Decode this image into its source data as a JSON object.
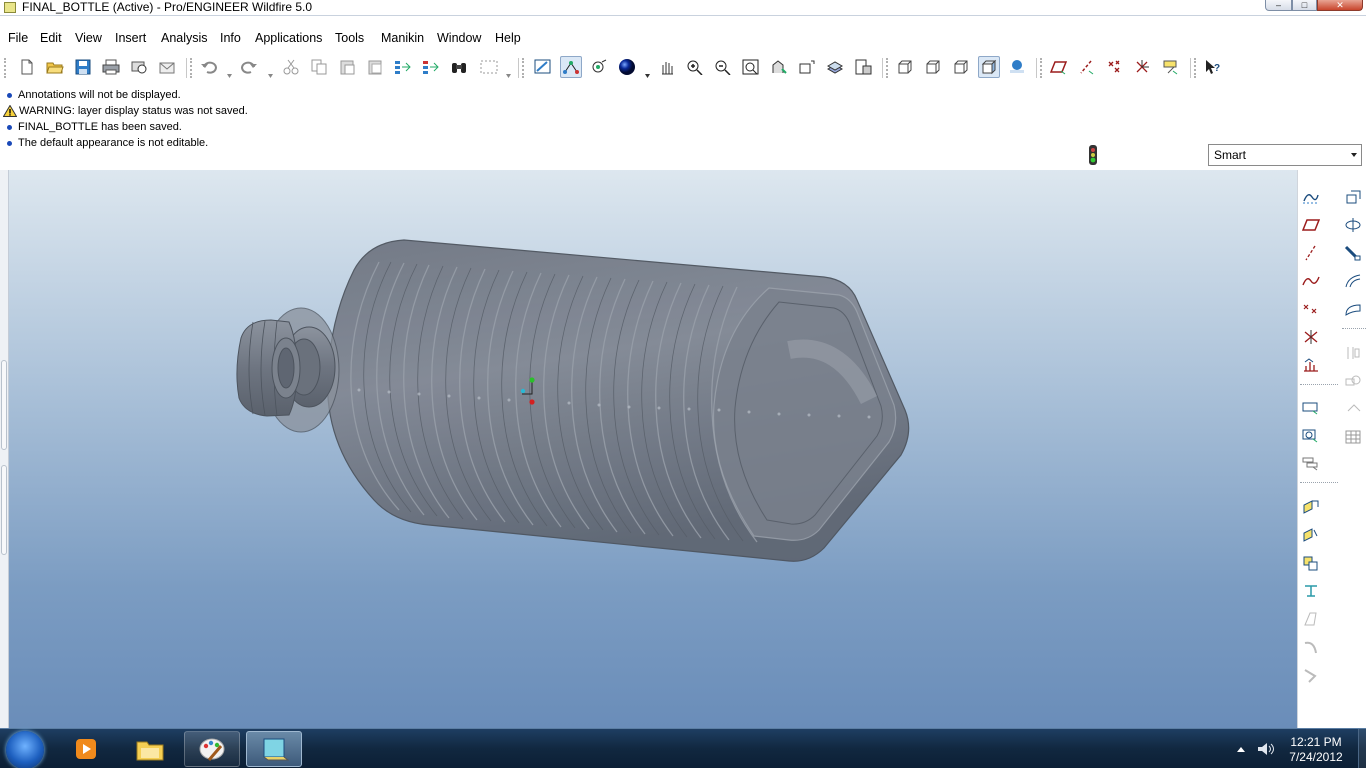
{
  "window": {
    "title": "FINAL_BOTTLE (Active) - Pro/ENGINEER Wildfire 5.0",
    "minimize_glyph": "–",
    "maximize_glyph": "□",
    "close_glyph": "✕"
  },
  "menu": [
    {
      "label": "File"
    },
    {
      "label": "Edit"
    },
    {
      "label": "View"
    },
    {
      "label": "Insert"
    },
    {
      "label": "Analysis"
    },
    {
      "label": "Info"
    },
    {
      "label": "Applications"
    },
    {
      "label": "Tools"
    },
    {
      "label": "Manikin"
    },
    {
      "label": "Window"
    },
    {
      "label": "Help"
    }
  ],
  "toolbar": {
    "buttons": [
      "new-icon",
      "open-icon",
      "save-icon",
      "print-icon",
      "print-preview-icon",
      "send-icon",
      "undo-icon",
      "redo-icon",
      "cut-icon",
      "copy-icon",
      "paste-icon",
      "paste-special-icon",
      "regenerate-icon",
      "regenerate-manager-icon",
      "find-icon",
      "select-box-icon",
      "repaint-icon",
      "spin-center-icon",
      "orient-mode-icon",
      "appearance-gallery-icon",
      "pan-icon",
      "zoom-in-icon",
      "zoom-out-icon",
      "refit-icon",
      "reorient-icon",
      "saved-views-icon",
      "layers-icon",
      "view-manager-icon",
      "wireframe-icon",
      "hidden-line-icon",
      "no-hidden-icon",
      "shading-icon",
      "enhanced-realism-icon",
      "datum-planes-icon",
      "datum-axes-icon",
      "datum-points-icon",
      "coordinate-systems-icon",
      "annotations-display-icon",
      "context-help-icon"
    ]
  },
  "messages": [
    {
      "type": "info",
      "text": "Annotations will not be displayed."
    },
    {
      "type": "warning",
      "text": "WARNING: layer display status was not saved."
    },
    {
      "type": "info",
      "text": "FINAL_BOTTLE has been saved."
    },
    {
      "type": "info",
      "text": "The default appearance is not editable."
    }
  ],
  "filter": {
    "value": "Smart"
  },
  "right_toolbar": {
    "column1": [
      "sketch-tool-icon",
      "datum-plane-tool-icon",
      "datum-axis-tool-icon",
      "datum-curve-tool-icon",
      "datum-point-tool-icon",
      "datum-point-offset-icon",
      "analysis-feature-icon",
      "hole-tool-icon",
      "shell-tool-icon",
      "rib-tool-icon",
      "draft-tool-icon",
      "round-tool-icon",
      "chamfer-tool-icon",
      "mirror-tool-icon",
      "merge-tool-icon",
      "trim-tool-icon",
      "offset-tool-icon",
      "extend-tool-icon"
    ],
    "column2": [
      "extrude-tool-icon",
      "revolve-tool-icon",
      "sweep-tool-icon",
      "boundary-blend-icon",
      "style-tool-icon",
      "pattern-tool-icon",
      "group-tool-icon",
      "copy-tool-icon",
      "grid-tool-icon"
    ]
  },
  "model": {
    "name": "FINAL_BOTTLE"
  },
  "colors": {
    "viewport_top": "#dde7ef",
    "viewport_bottom": "#6a8db9",
    "model_gray": "#7d8490",
    "info_bullet": "#1a49b8"
  },
  "taskbar": {
    "apps": [
      "windows-start-icon",
      "media-player-icon",
      "explorer-icon",
      "paint-icon",
      "proe-icon"
    ],
    "time": "12:21 PM",
    "date": "7/24/2012"
  }
}
